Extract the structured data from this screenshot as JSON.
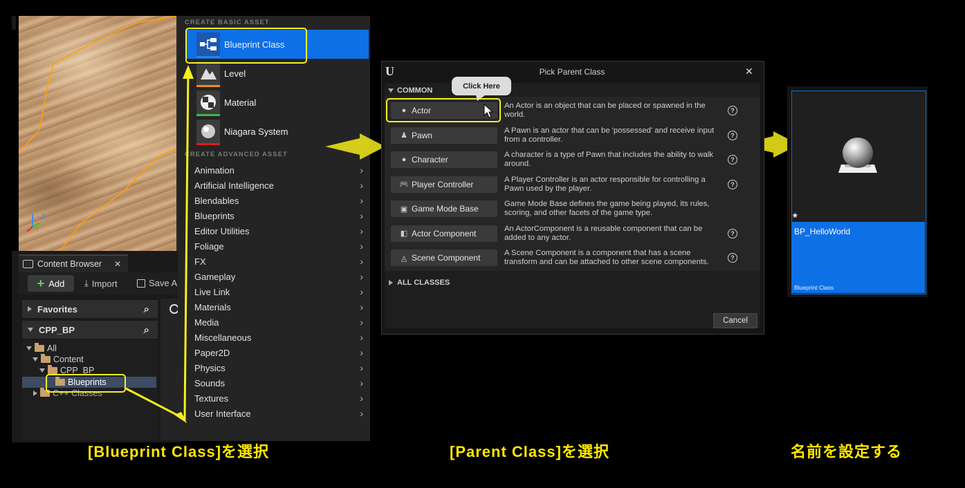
{
  "content_browser": {
    "tab_label": "Content Browser",
    "add_label": "Add",
    "import_label": "Import",
    "save_label": "Save A",
    "favorites_label": "Favorites",
    "project_label": "CPP_BP",
    "tree": {
      "all": "All",
      "content": "Content",
      "cpp_bp": "CPP_BP",
      "blueprints": "Blueprints",
      "cpp_classes": "C++ Classes"
    }
  },
  "asset_menu": {
    "basic_header": "CREATE BASIC ASSET",
    "basic_items": [
      {
        "label": "Blueprint Class",
        "bar_color": "#2f7de1"
      },
      {
        "label": "Level",
        "bar_color": "#f08a1c"
      },
      {
        "label": "Material",
        "bar_color": "#3fb83f"
      },
      {
        "label": "Niagara System",
        "bar_color": "#e0191e"
      }
    ],
    "advanced_header": "CREATE ADVANCED ASSET",
    "advanced_items": [
      "Animation",
      "Artificial Intelligence",
      "Blendables",
      "Blueprints",
      "Editor Utilities",
      "Foliage",
      "FX",
      "Gameplay",
      "Live Link",
      "Materials",
      "Media",
      "Miscellaneous",
      "Paper2D",
      "Physics",
      "Sounds",
      "Textures",
      "User Interface"
    ]
  },
  "dialog": {
    "title": "Pick Parent Class",
    "close": "✕",
    "common_label": "COMMON",
    "tooltip": "Click Here",
    "classes": [
      {
        "name": "Actor",
        "icon": "actor-icon",
        "desc": "An Actor is an object that can be placed or spawned in the world.",
        "help": true
      },
      {
        "name": "Pawn",
        "icon": "pawn-icon",
        "desc": "A Pawn is an actor that can be 'possessed' and receive input from a controller.",
        "help": true
      },
      {
        "name": "Character",
        "icon": "character-icon",
        "desc": "A character is a type of Pawn that includes the ability to walk around.",
        "help": true
      },
      {
        "name": "Player Controller",
        "icon": "gamepad-icon",
        "desc": "A Player Controller is an actor responsible for controlling a Pawn used by the player.",
        "help": true
      },
      {
        "name": "Game Mode Base",
        "icon": "game-mode-icon",
        "desc": "Game Mode Base defines the game being played, its rules, scoring, and other facets of the game type.",
        "help": false
      },
      {
        "name": "Actor Component",
        "icon": "actor-component-icon",
        "desc": "An ActorComponent is a reusable component that can be added to any actor.",
        "help": true
      },
      {
        "name": "Scene Component",
        "icon": "scene-component-icon",
        "desc": "A Scene Component is a component that has a scene transform and can be attached to other scene components.",
        "help": true
      }
    ],
    "all_classes_label": "ALL CLASSES",
    "cancel_label": "Cancel"
  },
  "asset_tile": {
    "name": "BP_HelloWorld",
    "type": "Blueprint Class",
    "modified_mark": "*"
  },
  "captions": {
    "step1": "[Blueprint Class]を選択",
    "step2": "[Parent Class]を選択",
    "step3": "名前を設定する"
  },
  "colors": {
    "highlight": "#f5ef1e",
    "selection": "#0e70e6",
    "caption": "#ffe800"
  }
}
